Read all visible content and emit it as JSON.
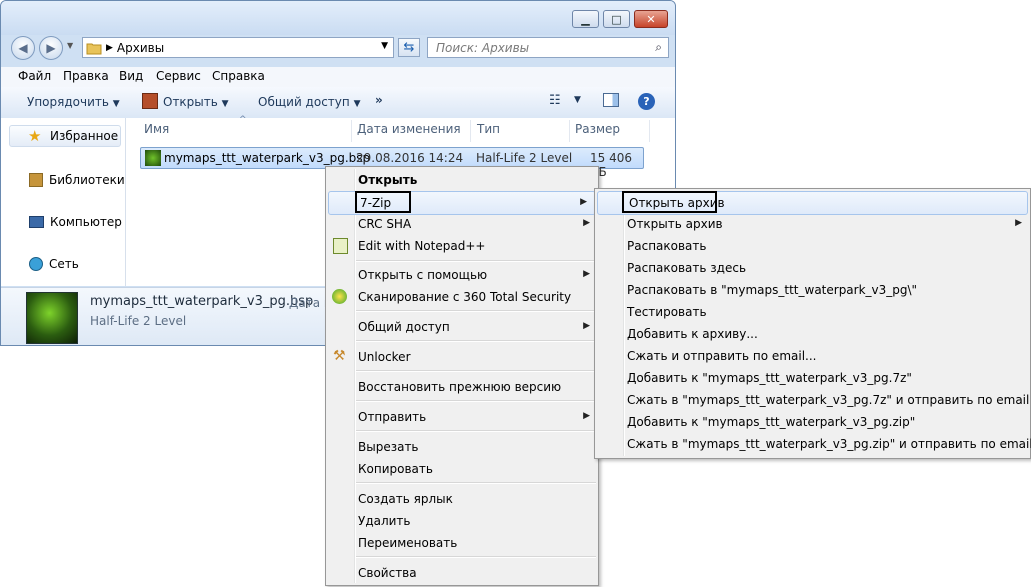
{
  "window": {
    "caption_buttons": [
      "minimize",
      "maximize",
      "close"
    ],
    "address": {
      "crumb": "Архивы"
    },
    "search": {
      "placeholder": "Поиск: Архивы"
    },
    "menubar": [
      "Файл",
      "Правка",
      "Вид",
      "Сервис",
      "Справка"
    ],
    "toolbar": {
      "organize": "Упорядочить",
      "open": "Открыть",
      "share": "Общий доступ",
      "more": "»"
    },
    "nav": [
      {
        "label": "Избранное",
        "icon": "star-icon"
      },
      {
        "label": "Библиотеки",
        "icon": "library-icon"
      },
      {
        "label": "Компьютер",
        "icon": "computer-icon"
      },
      {
        "label": "Сеть",
        "icon": "network-icon"
      }
    ],
    "columns": [
      "Имя",
      "Дата изменения",
      "Тип",
      "Размер"
    ],
    "file": {
      "name": "mymaps_ttt_waterpark_v3_pg.bsp",
      "date": "29.08.2016 14:24",
      "type": "Half-Life 2 Level",
      "size": "15 406 КБ"
    },
    "details": {
      "name": "mymaps_ttt_waterpark_v3_pg.bsp",
      "date_label": "Дата и",
      "type": "Half-Life 2 Level"
    }
  },
  "context_menu": {
    "items": [
      {
        "label": "Открыть",
        "bold": true
      },
      {
        "label": "7-Zip",
        "submenu": true
      },
      {
        "label": "CRC SHA",
        "submenu": true
      },
      {
        "label": "Edit with Notepad++"
      },
      {
        "label": "Открыть с помощью",
        "submenu": true
      },
      {
        "label": "Сканирование с 360 Total Security"
      },
      {
        "label": "Общий доступ",
        "submenu": true
      },
      {
        "label": "Unlocker"
      },
      {
        "label": "Восстановить прежнюю версию"
      },
      {
        "label": "Отправить",
        "submenu": true
      },
      {
        "label": "Вырезать"
      },
      {
        "label": "Копировать"
      },
      {
        "label": "Создать ярлык"
      },
      {
        "label": "Удалить"
      },
      {
        "label": "Переименовать"
      },
      {
        "label": "Свойства"
      }
    ]
  },
  "zip_submenu": {
    "items": [
      "Открыть архив",
      "Открыть архив",
      "Распаковать",
      "Распаковать здесь",
      "Распаковать в \"mymaps_ttt_waterpark_v3_pg\\\"",
      "Тестировать",
      "Добавить к архиву...",
      "Сжать и отправить по email...",
      "Добавить к \"mymaps_ttt_waterpark_v3_pg.7z\"",
      "Сжать в \"mymaps_ttt_waterpark_v3_pg.7z\" и отправить по email",
      "Добавить к \"mymaps_ttt_waterpark_v3_pg.zip\"",
      "Сжать в \"mymaps_ttt_waterpark_v3_pg.zip\" и отправить по email"
    ]
  },
  "colors": {
    "accent": "#1e395b",
    "selection": "#c1dbfc",
    "menu_bg": "#f0f0f0"
  }
}
